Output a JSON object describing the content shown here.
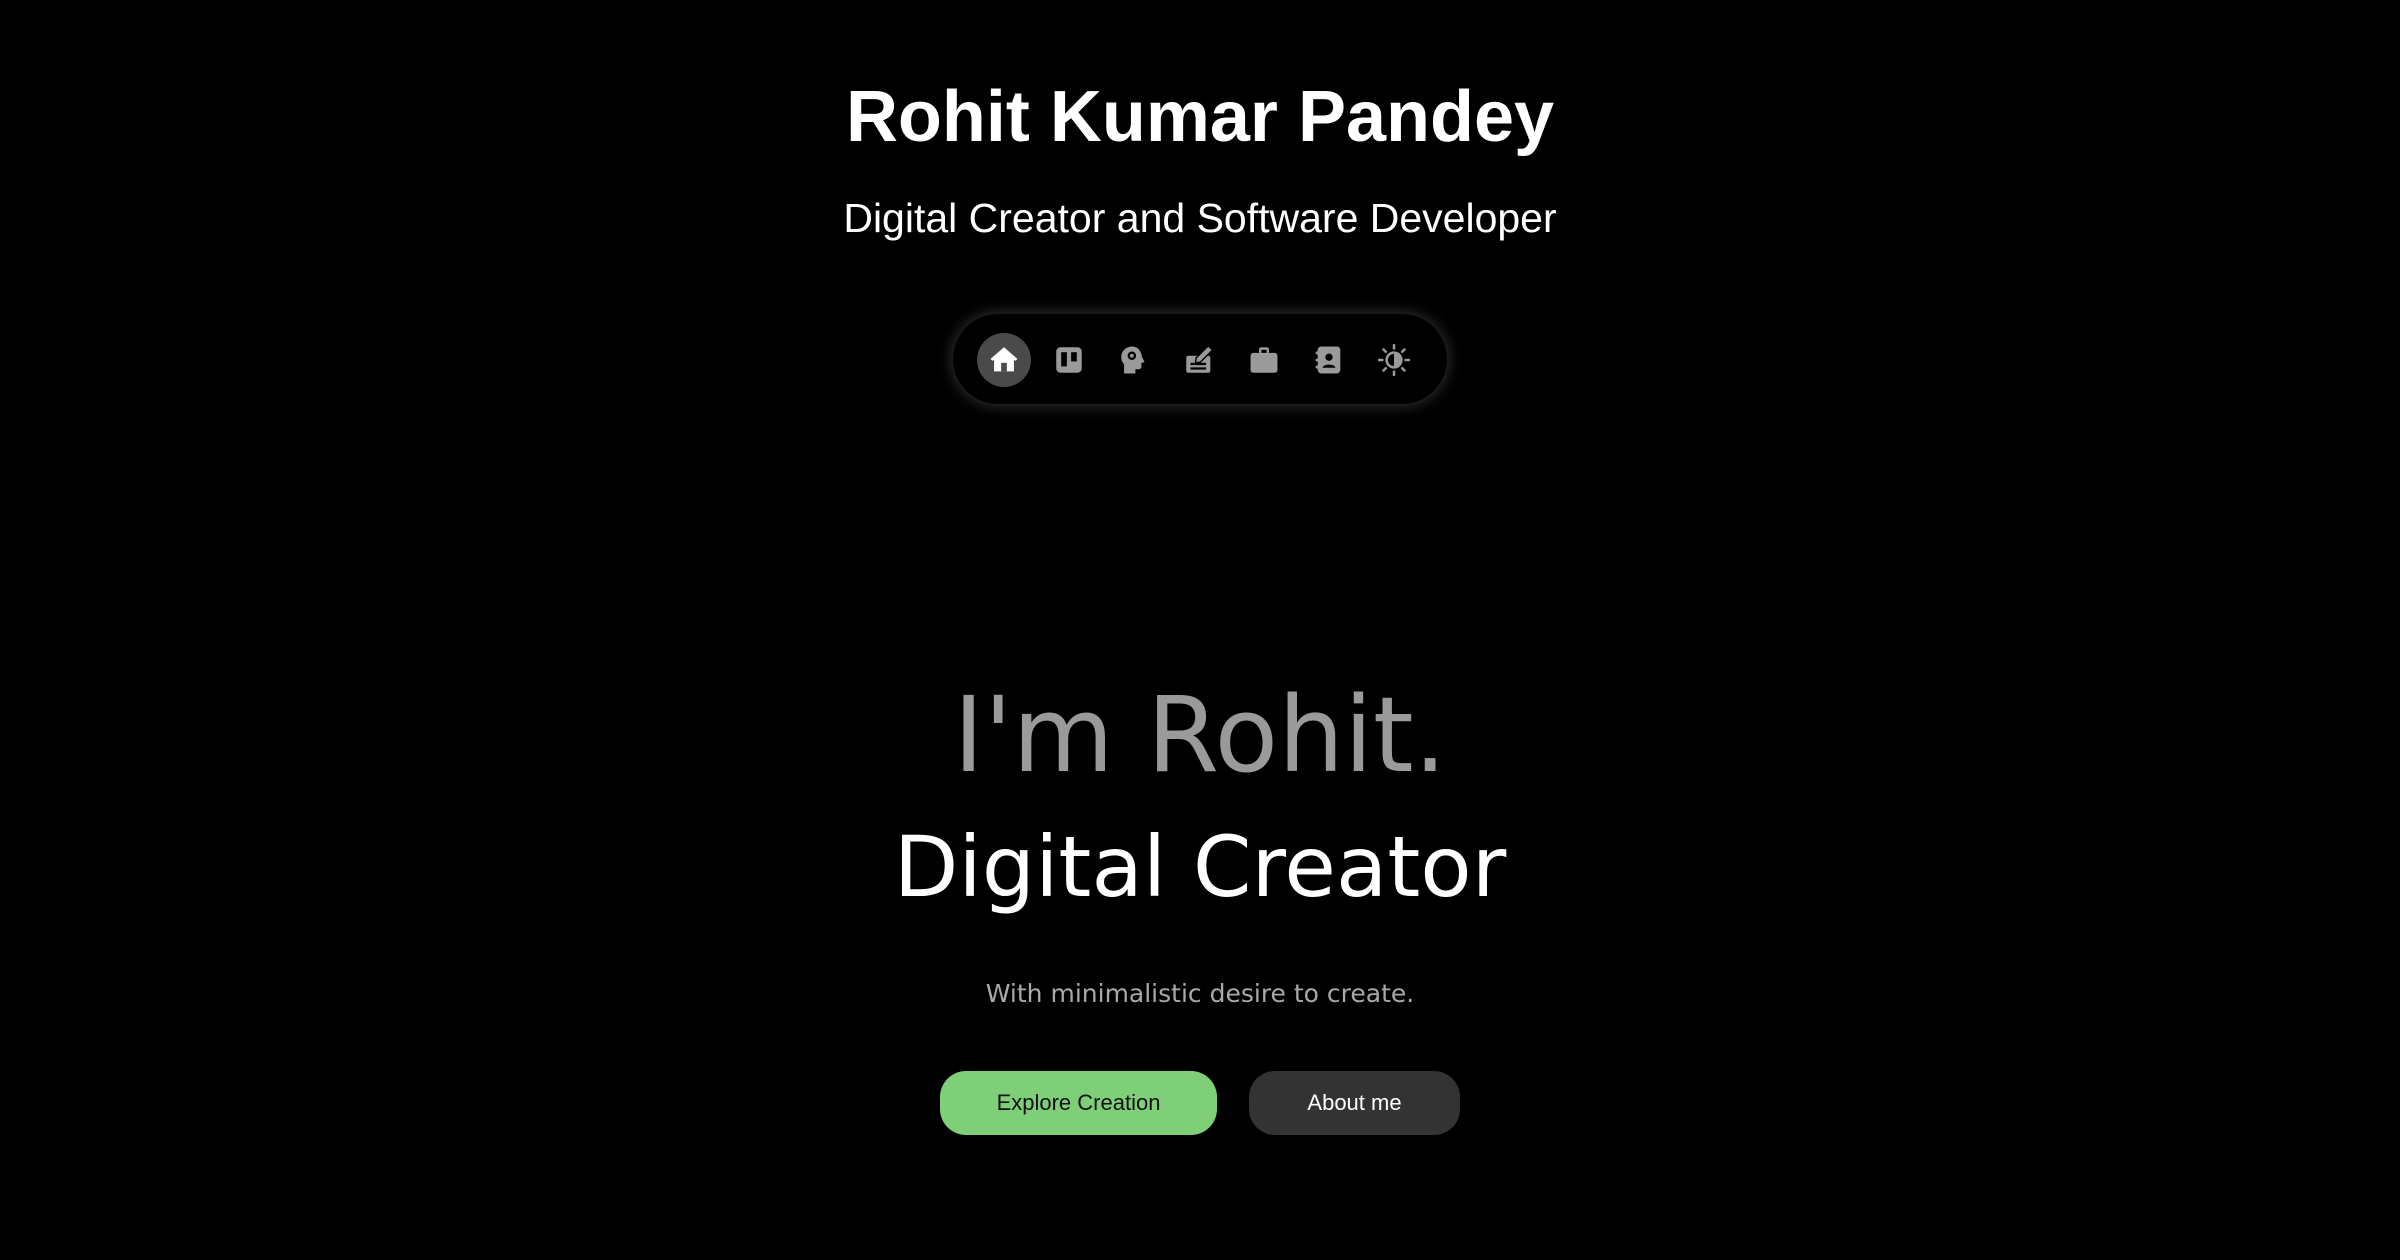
{
  "header": {
    "title": "Rohit Kumar Pandey",
    "subtitle": "Digital Creator and Software Developer"
  },
  "nav": {
    "items": [
      {
        "icon": "home-icon",
        "active": true
      },
      {
        "icon": "board-icon",
        "active": false
      },
      {
        "icon": "head-brain-icon",
        "active": false
      },
      {
        "icon": "blog-edit-icon",
        "active": false
      },
      {
        "icon": "briefcase-icon",
        "active": false
      },
      {
        "icon": "contact-book-icon",
        "active": false
      },
      {
        "icon": "theme-toggle-icon",
        "active": false
      }
    ]
  },
  "hero": {
    "intro": "I'm Rohit.",
    "role": "Digital Creator",
    "tagline": "With minimalistic desire to create."
  },
  "actions": {
    "primary_label": "Explore Creation",
    "secondary_label": "About me"
  },
  "colors": {
    "background": "#000000",
    "accent": "#7ecf78",
    "secondary_button": "#333333",
    "nav_active": "#4a4a4a",
    "icon": "#9a9a9a"
  }
}
